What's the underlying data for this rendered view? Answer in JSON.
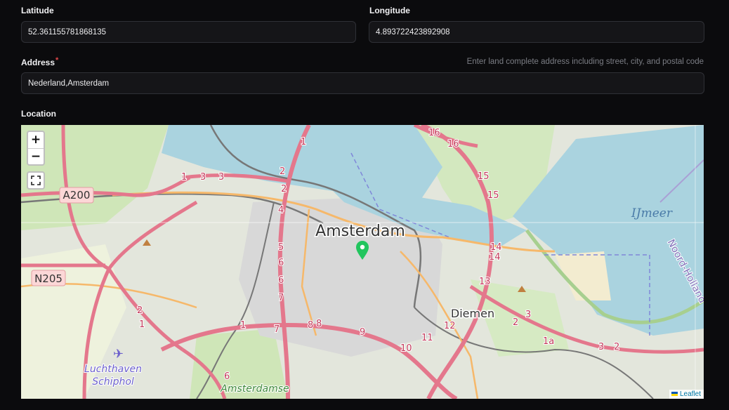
{
  "form": {
    "latitude": {
      "label": "Latitude",
      "value": "52.361155781868135"
    },
    "longitude": {
      "label": "Longitude",
      "value": "4.893722423892908"
    },
    "address": {
      "label": "Address",
      "required_mark": "*",
      "hint": "Enter land complete address including street, city, and postal code",
      "value": "Nederland,Amsterdam"
    },
    "location": {
      "label": "Location"
    }
  },
  "map": {
    "controls": {
      "zoom_in": "+",
      "zoom_out": "−",
      "fullscreen_icon": "fullscreen-icon"
    },
    "attribution": {
      "flag_icon": "ukraine-flag-icon",
      "link_text": "Leaflet"
    },
    "marker_color": "#22c55e",
    "place_labels": {
      "city": "Amsterdam",
      "diemen": "Diemen",
      "ijmeer": "IJmeer",
      "noord_holland": "Noord-Holland",
      "airport_line1": "Luchthaven",
      "airport_line2": "Schiphol",
      "amsterdamse": "Amsterdamse"
    },
    "road_shields": {
      "a200": "A200",
      "n205": "N205"
    },
    "ring_numbers": [
      "1",
      "2",
      "2",
      "3",
      "3",
      "4",
      "5",
      "6",
      "6",
      "7",
      "7",
      "8",
      "8",
      "9",
      "10",
      "11",
      "12",
      "13",
      "14",
      "14",
      "15",
      "15",
      "16",
      "16",
      "1",
      "1a",
      "2",
      "3",
      "6",
      "2",
      "1",
      "1",
      "2",
      "3"
    ]
  }
}
